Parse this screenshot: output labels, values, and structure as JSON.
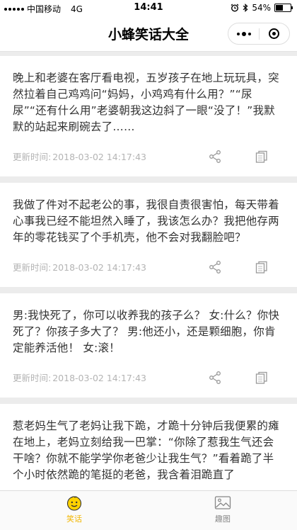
{
  "status_bar": {
    "carrier": "中国移动",
    "network": "4G",
    "time": "14:41",
    "battery_text": "54%",
    "battery_level": 0.54
  },
  "nav": {
    "title": "小蜂笑话大全"
  },
  "jokes": [
    {
      "text": "晚上和老婆在客厅看电视，五岁孩子在地上玩玩具，突然拉着自己鸡鸡问“妈妈，小鸡鸡有什么用？”“尿尿”“还有什么用”老婆朝我这边斜了一眼“没了！”我默默的站起来刷碗去了……",
      "time_label": "更新时间:",
      "time": "2018-03-02 14:17:43"
    },
    {
      "text": "我做了件对不起老公的事，我很自责很害怕，每天带着心事我已经不能坦然入睡了，我该怎么办？我把他存两年的零花钱买了个手机壳，他不会对我翻脸吧？",
      "time_label": "更新时间:",
      "time": "2018-03-02 14:17:43"
    },
    {
      "text": "男:我快死了，你可以收养我的孩子么？ 女:什么？你快死了？你孩子多大了？ 男:他还小，还是颗细胞，你肯定能养活他！ 女:滚！",
      "time_label": "更新时间:",
      "time": "2018-03-02 14:17:43"
    },
    {
      "text": "惹老妈生气了老妈让我下跪，才跪十分钟后我便累的瘫在地上，老妈立刻给我一巴掌：“你除了惹我生气还会干啥？你就不能学学你老爸少让我生气？”看着跪了半个小时依然跪的笔挺的老爸，我含着泪跪直了",
      "time_label": "更新时间:",
      "time": "2018-03-02 14:17:43"
    }
  ],
  "tabbar": {
    "tabs": [
      {
        "label": "笑话",
        "icon": "smiley-face-icon",
        "active": true
      },
      {
        "label": "趣图",
        "icon": "image-icon",
        "active": false
      }
    ]
  },
  "colors": {
    "accent": "#f2b600",
    "meta_text": "#b4b4b4",
    "background": "#ececec"
  }
}
